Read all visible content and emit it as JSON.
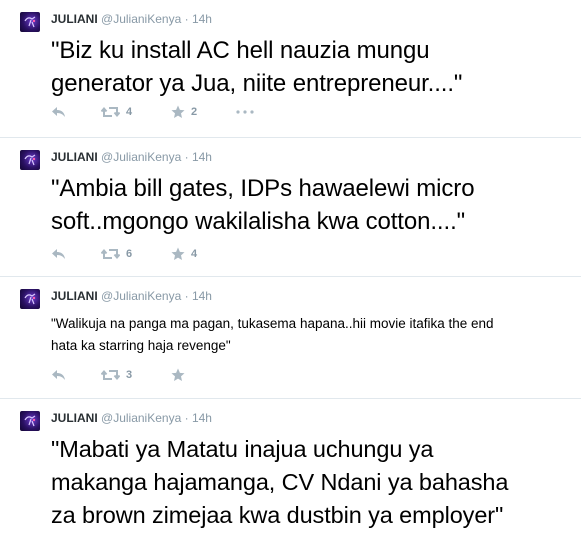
{
  "tweets": [
    {
      "name": "JULIANI",
      "handle": "@JulianiKenya",
      "separator": "·",
      "time": "14h",
      "text": "\"Biz ku install AC hell nauzia mungu\ngenerator ya Jua, niite entrepreneur....\"",
      "retweets": "4",
      "favorites": "2"
    },
    {
      "name": "JULIANI",
      "handle": "@JulianiKenya",
      "separator": "·",
      "time": "14h",
      "text": "\"Ambia bill gates, IDPs hawaelewi micro\nsoft..mgongo wakilalisha kwa cotton....\"",
      "retweets": "6",
      "favorites": "4"
    },
    {
      "name": "JULIANI",
      "handle": "@JulianiKenya",
      "separator": "·",
      "time": "14h",
      "text": "\"Walikuja na panga ma pagan, tukasema hapana..hii movie itafika the end\nhata ka starring haja revenge\"",
      "retweets": "3",
      "favorites": ""
    },
    {
      "name": "JULIANI",
      "handle": "@JulianiKenya",
      "separator": "·",
      "time": "14h",
      "text": "\"Mabati ya Matatu inajua uchungu ya\nmakanga hajamanga, CV Ndani ya bahasha\nza brown zimejaa kwa dustbin ya employer\"",
      "retweets": "",
      "favorites": ""
    }
  ],
  "icons": {
    "reply": "reply-icon",
    "retweet": "retweet-icon",
    "favorite": "star-icon",
    "more": "ellipsis-icon"
  },
  "colors": {
    "name": "#292f33",
    "meta": "#8899a6",
    "icon": "#aab8c2",
    "divider": "#e1e8ed"
  }
}
